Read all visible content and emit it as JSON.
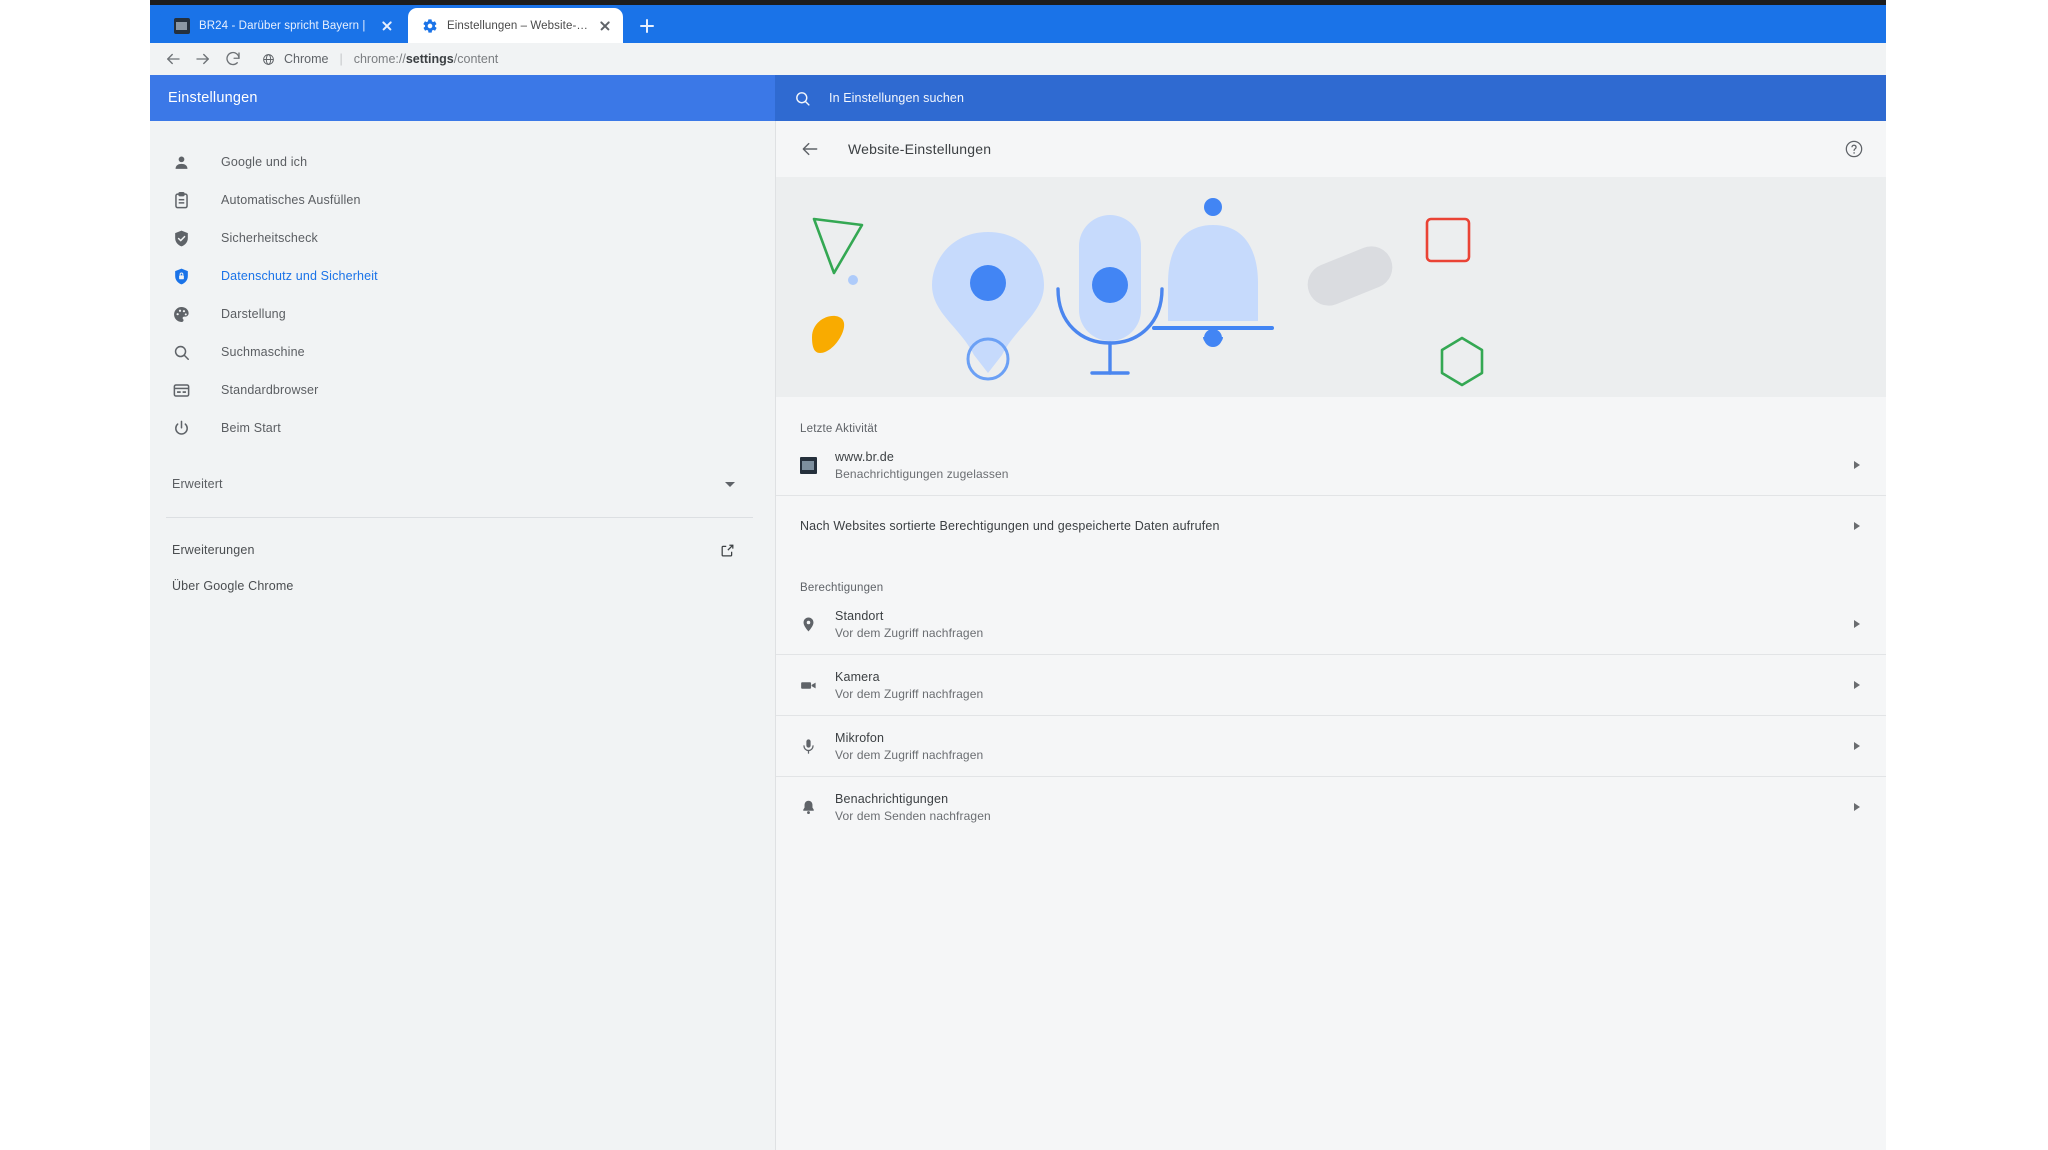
{
  "browser": {
    "tabs": [
      {
        "title": "BR24 - Darüber spricht Bayern | ",
        "favicon": "br24-favicon",
        "active": false
      },
      {
        "title": "Einstellungen – Website-Einstel...",
        "favicon": "settings-gear-favicon",
        "active": true
      }
    ],
    "new_tab_label": "+",
    "toolbar": {
      "back_label": "Zurück",
      "forward_label": "Vorwärts",
      "reload_label": "Neu laden",
      "omnibox_scheme": "Chrome",
      "omnibox_separator": "|",
      "omnibox_url_prefix": "chrome://",
      "omnibox_url_bold": "settings",
      "omnibox_url_suffix": "/content"
    }
  },
  "settings": {
    "app_title": "Einstellungen",
    "search": {
      "placeholder": "In Einstellungen suchen",
      "value": "",
      "icon": "search-icon"
    },
    "sidebar": {
      "items": [
        {
          "label": "Google und ich",
          "icon": "person-icon",
          "selected": false
        },
        {
          "label": "Automatisches Ausfüllen",
          "icon": "clipboard-icon",
          "selected": false
        },
        {
          "label": "Sicherheitscheck",
          "icon": "shield-check-icon",
          "selected": false
        },
        {
          "label": "Datenschutz und Sicherheit",
          "icon": "shield-lock-icon",
          "selected": true
        },
        {
          "label": "Darstellung",
          "icon": "palette-icon",
          "selected": false
        },
        {
          "label": "Suchmaschine",
          "icon": "search-icon",
          "selected": false
        },
        {
          "label": "Standardbrowser",
          "icon": "browser-window-icon",
          "selected": false
        },
        {
          "label": "Beim Start",
          "icon": "power-icon",
          "selected": false
        }
      ],
      "expand": {
        "label": "Erweitert",
        "icon": "chevron-down-icon"
      },
      "links": [
        {
          "label": "Erweiterungen",
          "icon": "external-link-icon"
        },
        {
          "label": "Über Google Chrome",
          "icon": ""
        }
      ]
    },
    "page": {
      "back_icon": "back-arrow-icon",
      "title": "Website-Einstellungen",
      "help_icon": "help-circle-icon",
      "hero": {
        "name": "site-settings-illustration",
        "shapes": [
          "triangle-outline-green",
          "dot-blue",
          "blob-yellow",
          "location-pin-blue",
          "microphone-blue",
          "bell-blue",
          "capsule-grey",
          "square-outline-red",
          "hexagon-outline-green"
        ],
        "colors": {
          "triangle": "#34a853",
          "dot": "#aecbfa",
          "blob": "#f9ab00",
          "fill_light": "#c6dafc",
          "accent_blue": "#4285f4",
          "capsule": "#dadce0",
          "square": "#ea4335",
          "hexagon": "#34a853"
        }
      },
      "recent_activity": {
        "label": "Letzte Aktivität",
        "entries": [
          {
            "title": "www.br.de",
            "subtitle": "Benachrichtigungen zugelassen",
            "icon": "br-site-favicon",
            "chevron": "chevron-right-icon"
          }
        ]
      },
      "all_sites_row": {
        "label": "Nach Websites sortierte Berechtigungen und gespeicherte Daten aufrufen",
        "chevron": "chevron-right-icon"
      },
      "permissions": {
        "label": "Berechtigungen",
        "items": [
          {
            "title": "Standort",
            "subtitle": "Vor dem Zugriff nachfragen",
            "icon": "location-pin-icon",
            "chevron": "chevron-right-icon"
          },
          {
            "title": "Kamera",
            "subtitle": "Vor dem Zugriff nachfragen",
            "icon": "camera-icon",
            "chevron": "chevron-right-icon"
          },
          {
            "title": "Mikrofon",
            "subtitle": "Vor dem Zugriff nachfragen",
            "icon": "microphone-icon",
            "chevron": "chevron-right-icon"
          },
          {
            "title": "Benachrichtigungen",
            "subtitle": "Vor dem Senden nachfragen",
            "icon": "bell-icon",
            "chevron": "chevron-right-icon"
          }
        ]
      }
    }
  }
}
